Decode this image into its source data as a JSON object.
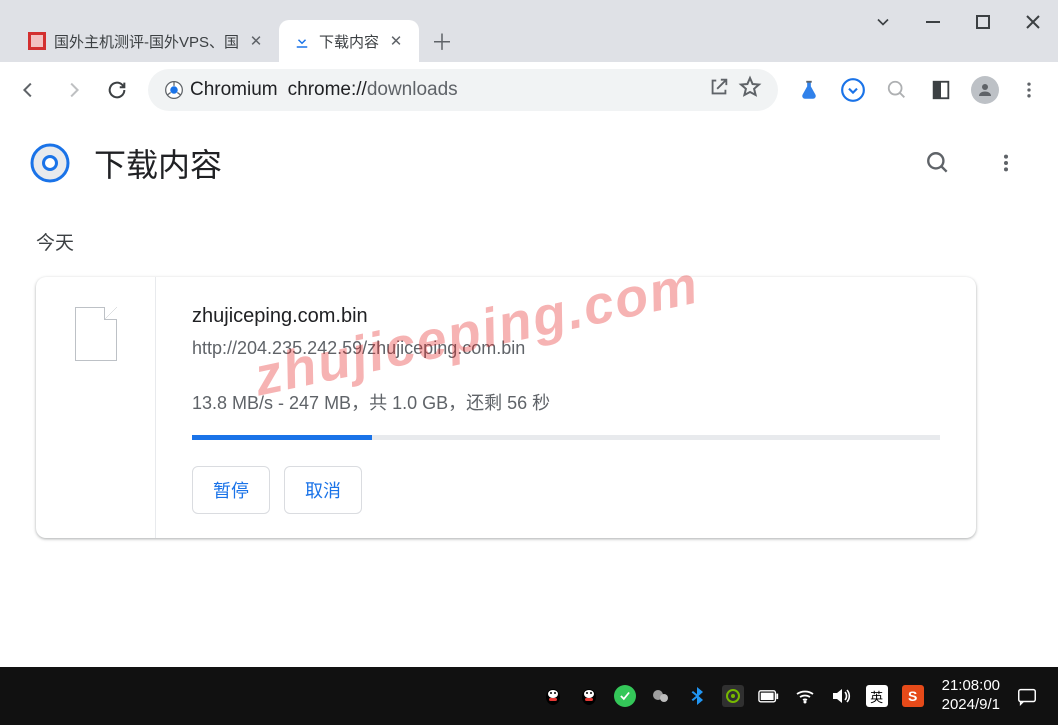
{
  "window": {
    "tabs": [
      {
        "label": "国外主机测评-国外VPS、国",
        "favicon_color": "#d32f2f"
      },
      {
        "label": "下载内容",
        "favicon_glyph": "⭳"
      }
    ],
    "controls": {
      "expand": "⌄"
    }
  },
  "toolbar": {
    "omnibox_chip": "Chromium",
    "url_dark": "chrome://",
    "url_rest": "downloads"
  },
  "downloads_page": {
    "title": "下载内容",
    "section_today": "今天",
    "item": {
      "filename": "zhujiceping.com.bin",
      "url": "http://204.235.242.59/zhujiceping.com.bin",
      "status": "13.8 MB/s - 247 MB，共 1.0 GB，还剩 56 秒",
      "progress_percent": 24,
      "pause_label": "暂停",
      "cancel_label": "取消"
    }
  },
  "watermark": "zhujiceping.com",
  "taskbar": {
    "ime": "英",
    "sogou": "S",
    "time": "21:08:00",
    "date": "2024/9/1"
  }
}
